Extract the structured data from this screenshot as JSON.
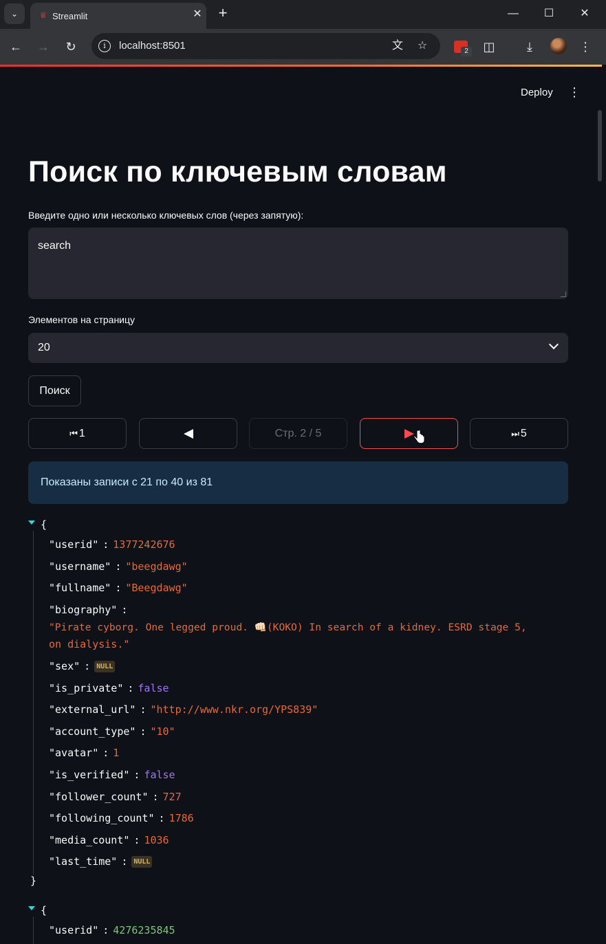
{
  "browser": {
    "tab_title": "Streamlit",
    "url": "localhost:8501",
    "extension_badge": "2"
  },
  "app": {
    "deploy_label": "Deploy",
    "title": "Поиск по ключевым словам",
    "keywords_label": "Введите одно или несколько ключевых слов (через запятую):",
    "keywords_value": "search",
    "page_size_label": "Элементов на страницу",
    "page_size_value": "20",
    "search_button": "Поиск",
    "pagination": {
      "first_label": "1",
      "page_info": "Стр. 2 / 5",
      "last_label": "5"
    },
    "info_message": "Показаны записи с 21 по 40 из 81"
  },
  "records": [
    {
      "userid_key": "\"userid\"",
      "userid": "1377242676",
      "username_key": "\"username\"",
      "username": "\"beegdawg\"",
      "fullname_key": "\"fullname\"",
      "fullname": "\"Beegdawg\"",
      "biography_key": "\"biography\"",
      "biography_line1": "\"Pirate cyborg. One legged proud. 👊🏻(KOKO) In search of a kidney. ESRD stage 5,",
      "biography_line2": "on dialysis.\"",
      "sex_key": "\"sex\"",
      "null_label": "NULL",
      "is_private_key": "\"is_private\"",
      "is_private": "false",
      "external_url_key": "\"external_url\"",
      "external_url": "\"http://www.nkr.org/YPS839\"",
      "account_type_key": "\"account_type\"",
      "account_type": "\"10\"",
      "avatar_key": "\"avatar\"",
      "avatar": "1",
      "is_verified_key": "\"is_verified\"",
      "is_verified": "false",
      "follower_count_key": "\"follower_count\"",
      "follower_count": "727",
      "following_count_key": "\"following_count\"",
      "following_count": "1786",
      "media_count_key": "\"media_count\"",
      "media_count": "1036",
      "last_time_key": "\"last_time\""
    },
    {
      "userid_key": "\"userid\"",
      "userid": "4276235845"
    }
  ],
  "json_syntax": {
    "open": "{",
    "close": "}",
    "colon": ":"
  },
  "colors": {
    "accent": "#ff4b4b",
    "info_bg": "#172d43",
    "number": "#e56a3a",
    "boolean": "#a374f5"
  }
}
